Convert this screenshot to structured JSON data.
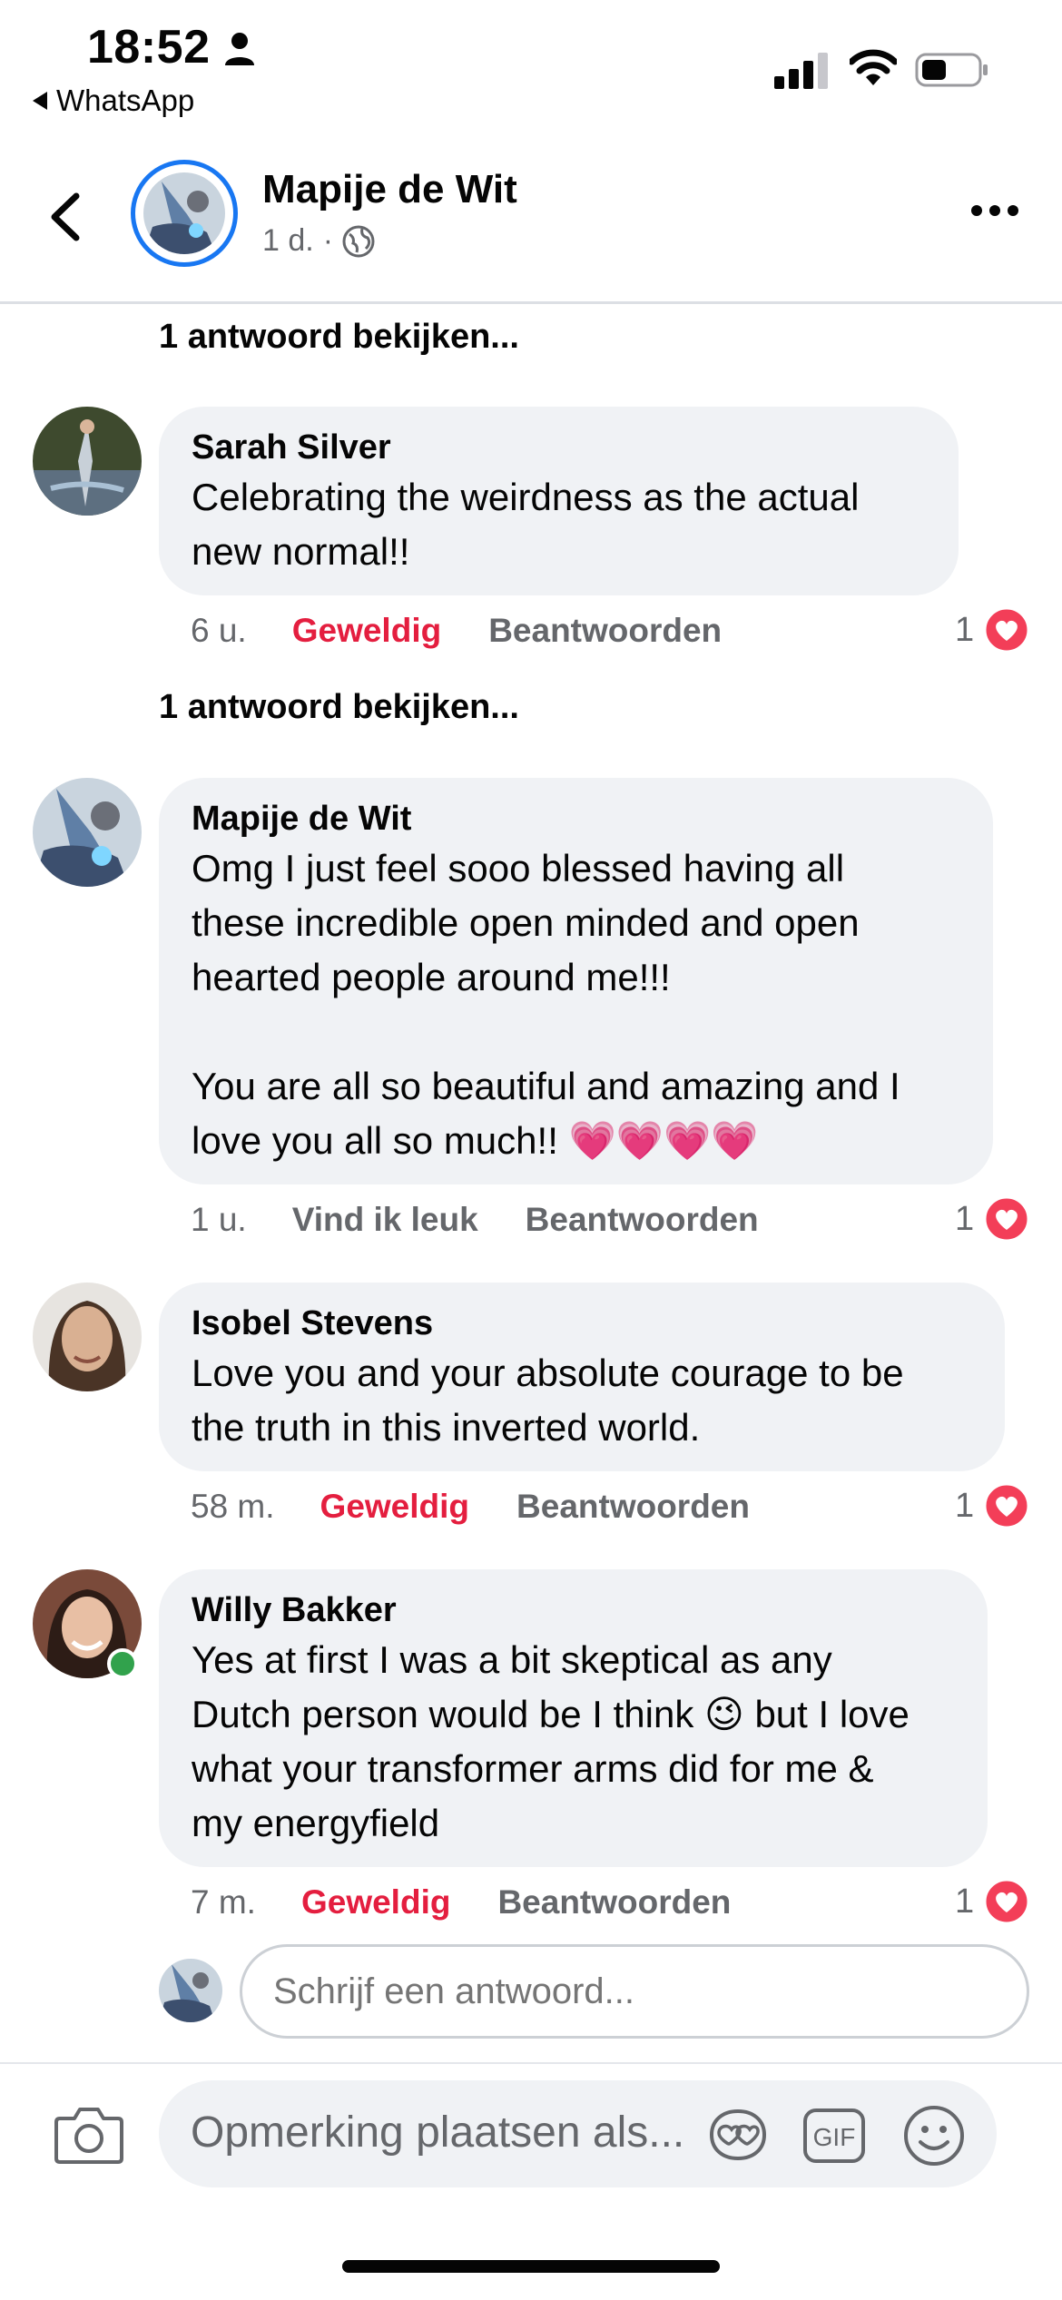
{
  "status_bar": {
    "time": "18:52",
    "back_app": "WhatsApp"
  },
  "header": {
    "name": "Mapije de Wit",
    "age": "1 d.",
    "separator": "·"
  },
  "comments": [
    {
      "view_replies_above": "1 antwoord bekijken...",
      "author": "Sarah Silver",
      "text": "Celebrating the weirdness as the actual new normal!!",
      "time": "6 u.",
      "reaction_label": "Geweldig",
      "reply_label": "Beantwoorden",
      "reaction_count": "1"
    },
    {
      "view_replies_above": "1 antwoord bekijken...",
      "author": "Mapije de Wit",
      "text": "Omg I just feel sooo blessed having all\nthese incredible open minded and open\nhearted people around me!!!\n\nYou are all so beautiful and amazing and I\nlove you all so much!! 💗💗💗💗",
      "time": "1 u.",
      "reaction_label": "Vind ik leuk",
      "reply_label": "Beantwoorden",
      "reaction_count": "1"
    },
    {
      "author": "Isobel Stevens",
      "text": "Love you and your absolute courage to be\nthe truth in this inverted world.",
      "time": "58 m.",
      "reaction_label": "Geweldig",
      "reply_label": "Beantwoorden",
      "reaction_count": "1"
    },
    {
      "author": "Willy Bakker",
      "text": "Yes at first I was a bit skeptical as any\nDutch person would be I think 😉 but I love\nwhat your transformer arms did for me &\nmy energyfield",
      "time": "7 m.",
      "reaction_label": "Geweldig",
      "reply_label": "Beantwoorden",
      "reaction_count": "1"
    }
  ],
  "reply_box": {
    "placeholder": "Schrijf een antwoord..."
  },
  "composer": {
    "placeholder": "Opmerking plaatsen als...",
    "gif_label": "GIF"
  },
  "colors": {
    "accent_blue": "#1877f2",
    "love_red": "#e41e3f",
    "online_green": "#31a24c",
    "bubble_gray": "#f0f2f5"
  },
  "icons": [
    "person-icon",
    "signal-icon",
    "wifi-icon",
    "battery-icon",
    "back-chevron-icon",
    "globe-icon",
    "more-icon",
    "heart-icon",
    "camera-icon",
    "sticker-icon",
    "gif-icon",
    "emoji-icon"
  ]
}
